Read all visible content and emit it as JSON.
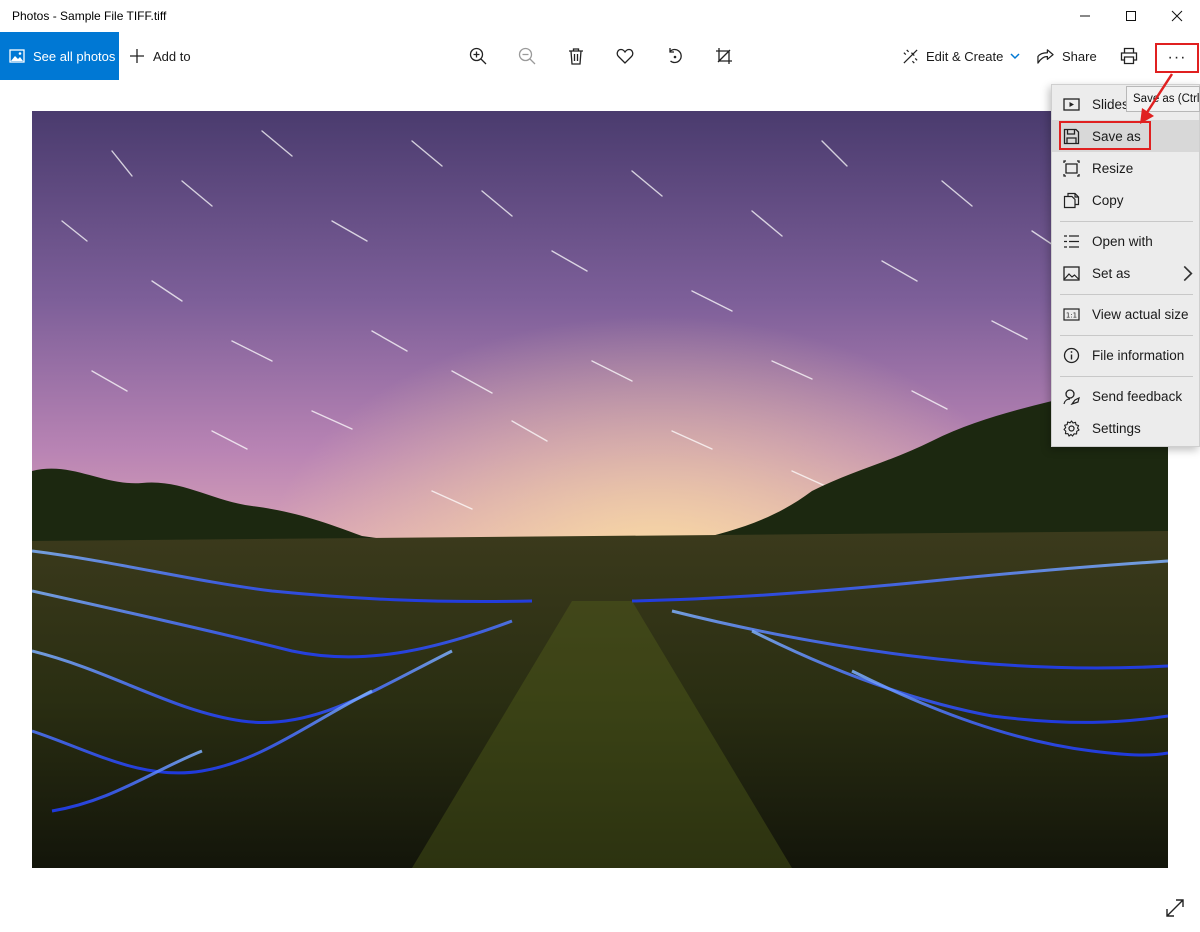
{
  "window": {
    "title": "Photos - Sample File TIFF.tiff"
  },
  "toolbar": {
    "see_all_label": "See all photos",
    "add_to_label": "Add to",
    "edit_create_label": "Edit & Create",
    "share_label": "Share",
    "more_label": "···",
    "icons": [
      "zoom-in-icon",
      "zoom-out-icon",
      "delete-icon",
      "heart-icon",
      "rotate-icon",
      "crop-icon",
      "print-icon"
    ]
  },
  "menu": {
    "items": [
      {
        "label": "Slideshow",
        "icon": "slideshow-icon"
      },
      {
        "label": "Save as",
        "icon": "save-icon"
      },
      {
        "label": "Resize",
        "icon": "resize-icon"
      },
      {
        "label": "Copy",
        "icon": "copy-icon"
      },
      {
        "label": "Open with",
        "icon": "open-with-icon"
      },
      {
        "label": "Set as",
        "icon": "set-as-icon"
      },
      {
        "label": "View actual size",
        "icon": "actual-size-icon"
      },
      {
        "label": "File information",
        "icon": "info-icon"
      },
      {
        "label": "Send feedback",
        "icon": "feedback-icon"
      },
      {
        "label": "Settings",
        "icon": "gear-icon"
      }
    ]
  },
  "tooltip": {
    "text": "Save as (Ctrl+S)"
  },
  "colors": {
    "accent": "#0078d4",
    "highlight": "#e02020",
    "menu_bg": "#ececec"
  }
}
